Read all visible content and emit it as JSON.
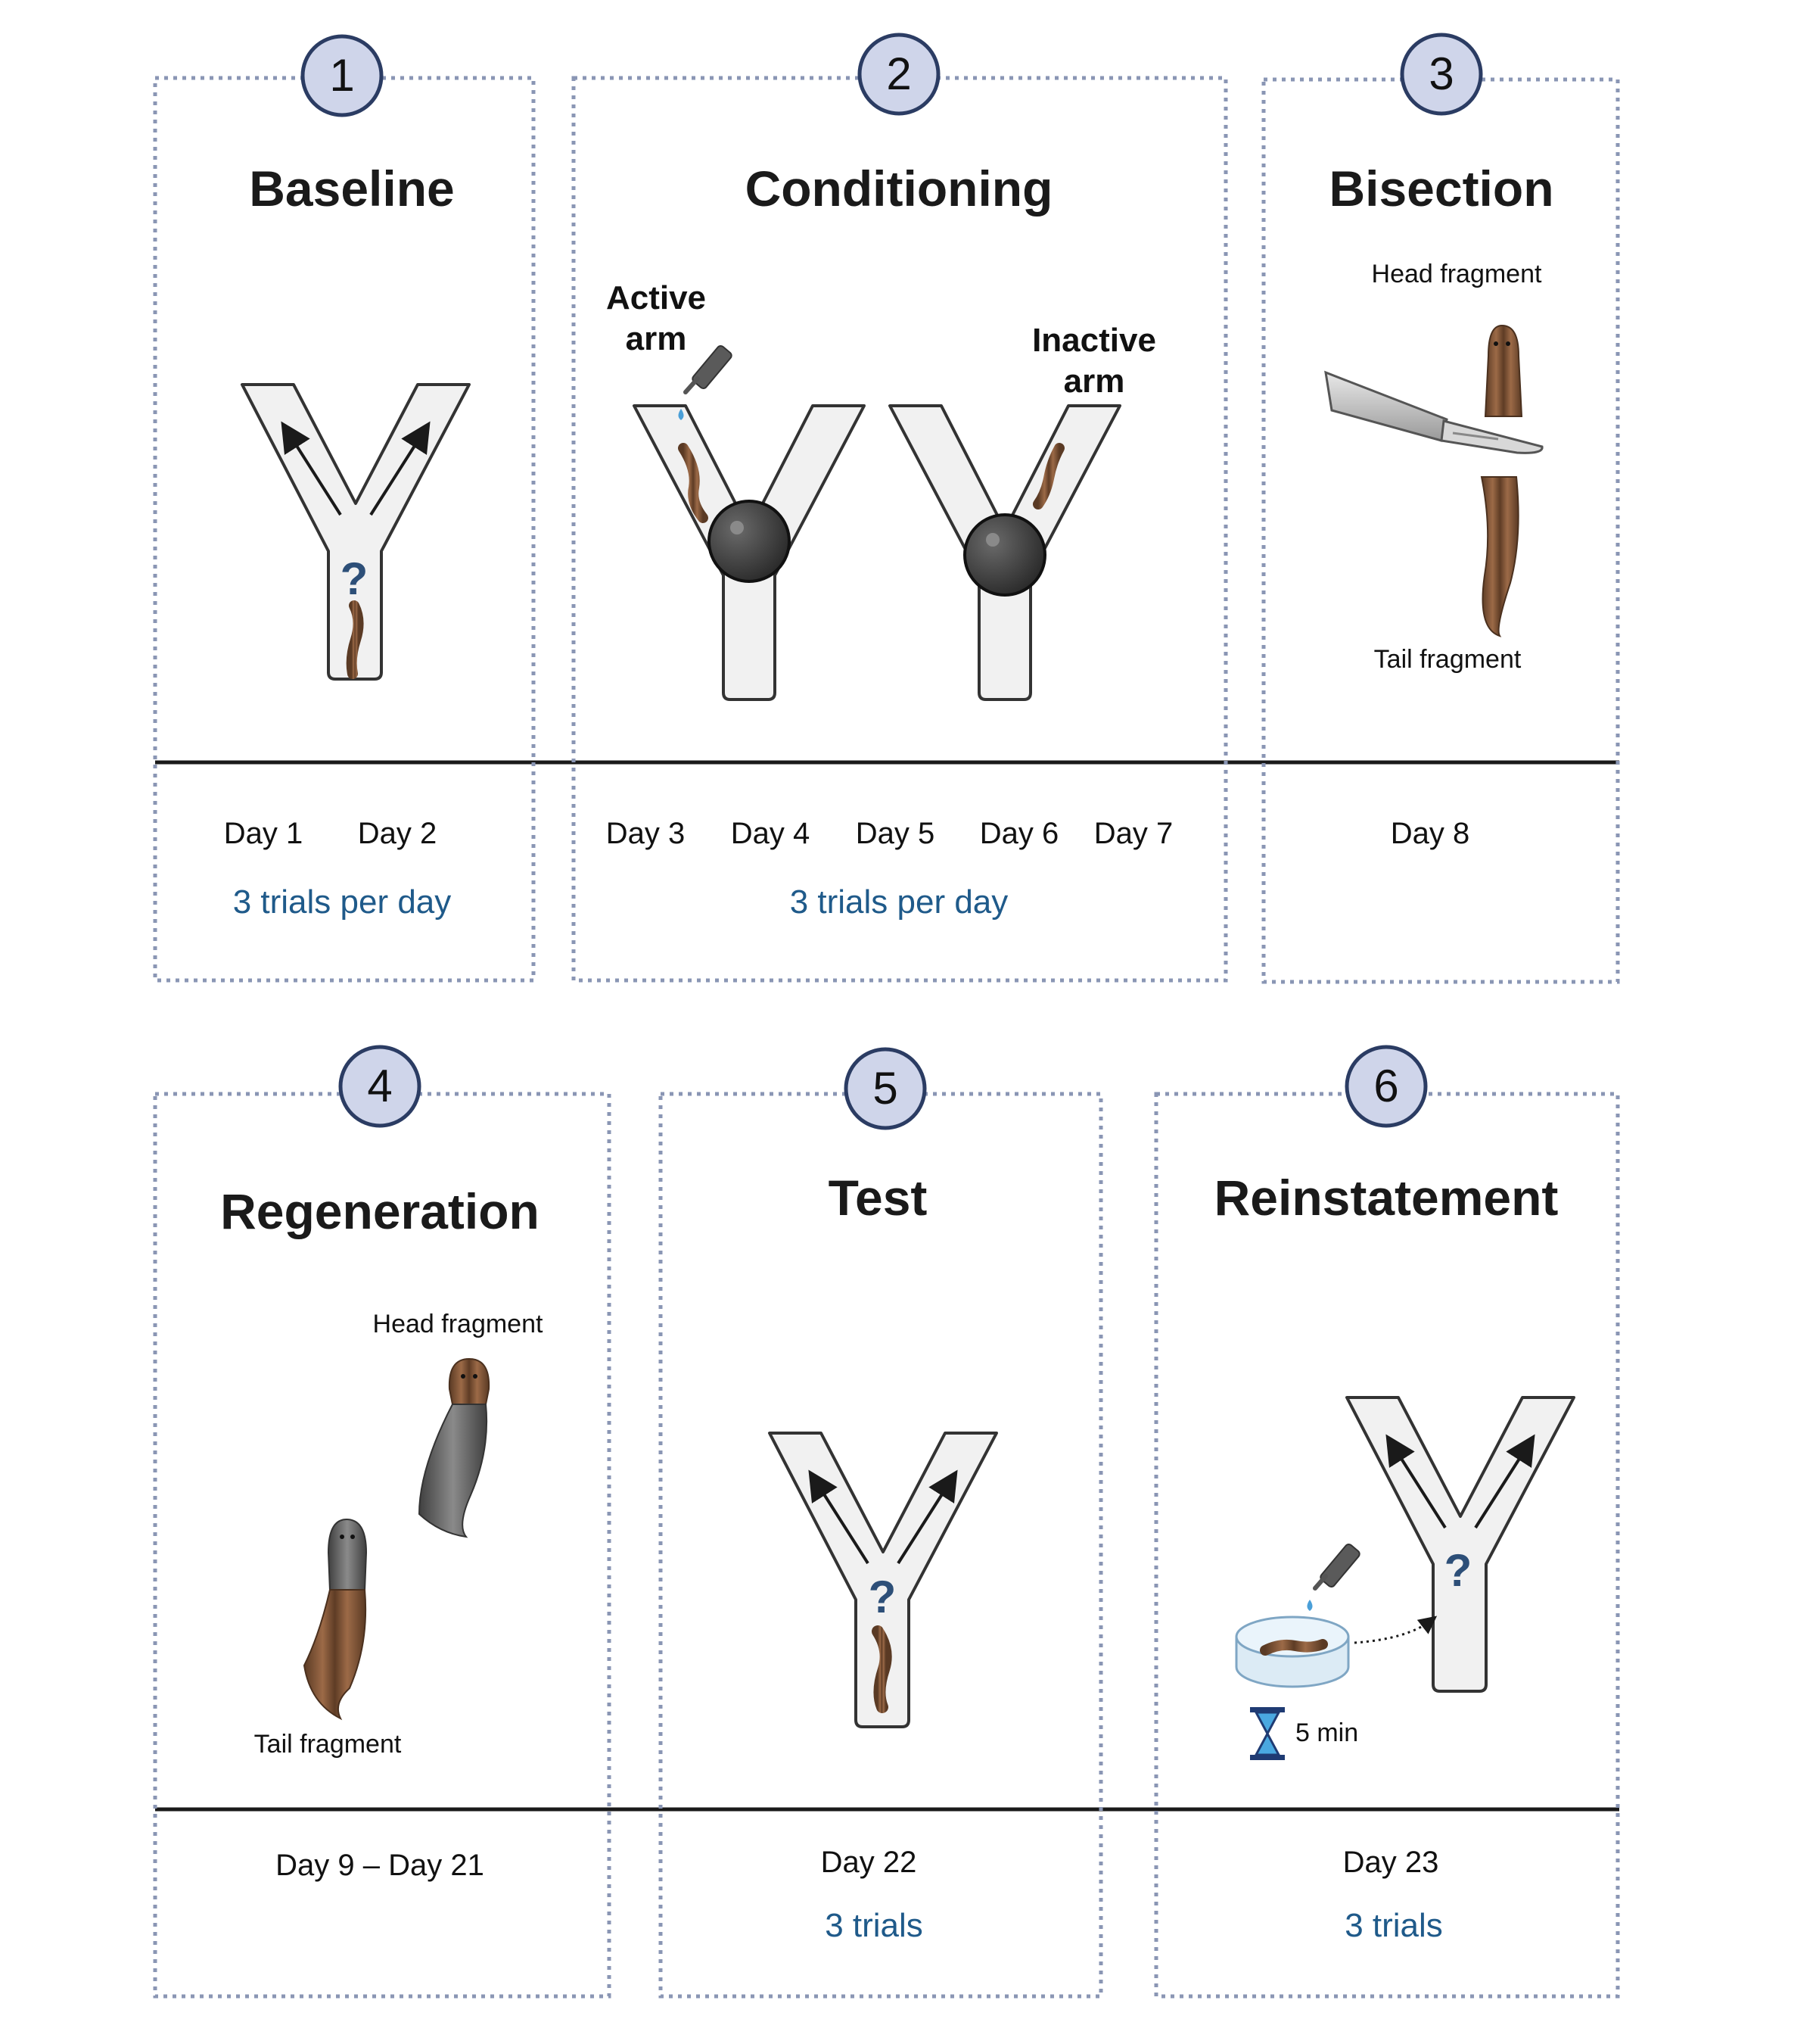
{
  "steps": [
    {
      "number": "1",
      "title": "Baseline",
      "days": [
        "Day 1",
        "Day 2"
      ],
      "trials": "3 trials per day"
    },
    {
      "number": "2",
      "title": "Conditioning",
      "days": [
        "Day 3",
        "Day 4",
        "Day 5",
        "Day 6",
        "Day 7"
      ],
      "trials": "3 trials per day",
      "labels": {
        "active_line1": "Active",
        "active_line2": "arm",
        "inactive_line1": "Inactive",
        "inactive_line2": "arm"
      }
    },
    {
      "number": "3",
      "title": "Bisection",
      "days": [
        "Day 8"
      ],
      "trials": "",
      "labels": {
        "head": "Head fragment",
        "tail": "Tail fragment"
      }
    },
    {
      "number": "4",
      "title": "Regeneration",
      "days": [
        "Day 9 – Day 21"
      ],
      "trials": "",
      "labels": {
        "head": "Head fragment",
        "tail": "Tail fragment"
      }
    },
    {
      "number": "5",
      "title": "Test",
      "days": [
        "Day 22"
      ],
      "trials": "3 trials"
    },
    {
      "number": "6",
      "title": "Reinstatement",
      "days": [
        "Day 23"
      ],
      "trials": "3 trials",
      "labels": {
        "timer": "5 min"
      }
    }
  ],
  "maze_question_mark": "?",
  "colors": {
    "panel_border": "#8a96b4",
    "badge_fill": "#cfd5ea",
    "badge_stroke": "#2b3c63",
    "trials_text": "#1f5a8a",
    "worm": "#8a5a3a",
    "regenerated": "#6b6b6b",
    "water": "#4a9fd8",
    "ball": "#3a3a3a"
  },
  "icons": [
    "y-maze-icon",
    "planarian-icon",
    "dropper-icon",
    "scalpel-icon",
    "petri-dish-icon",
    "hourglass-icon",
    "ball-icon"
  ]
}
